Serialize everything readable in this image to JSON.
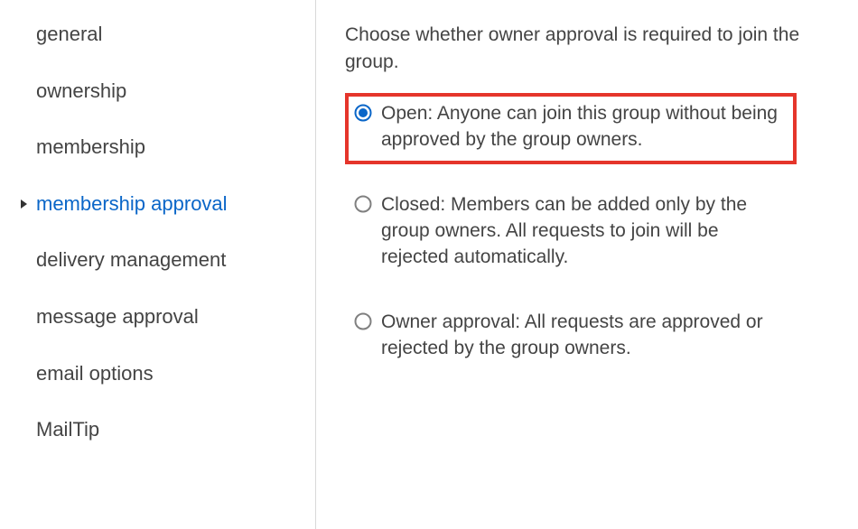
{
  "sidebar": {
    "items": [
      {
        "id": "general",
        "label": "general",
        "active": false
      },
      {
        "id": "ownership",
        "label": "ownership",
        "active": false
      },
      {
        "id": "membership",
        "label": "membership",
        "active": false
      },
      {
        "id": "membership-approval",
        "label": "membership approval",
        "active": true
      },
      {
        "id": "delivery-management",
        "label": "delivery management",
        "active": false
      },
      {
        "id": "message-approval",
        "label": "message approval",
        "active": false
      },
      {
        "id": "email-options",
        "label": "email options",
        "active": false
      },
      {
        "id": "mailtip",
        "label": "MailTip",
        "active": false
      }
    ]
  },
  "main": {
    "heading": "Choose whether owner approval is required to join the group.",
    "options": [
      {
        "id": "open",
        "label": "Open: Anyone can join this group without being approved by the group owners.",
        "selected": true,
        "highlighted": true
      },
      {
        "id": "closed",
        "label": "Closed: Members can be added only by the group owners. All requests to join will be rejected automatically.",
        "selected": false,
        "highlighted": false
      },
      {
        "id": "owner-approval",
        "label": "Owner approval: All requests are approved or rejected by the group owners.",
        "selected": false,
        "highlighted": false
      }
    ]
  },
  "colors": {
    "accent": "#0a66c8",
    "highlightBorder": "#e5352b",
    "radioSelected": "#0a66c8",
    "radioUnselected": "#808080"
  }
}
